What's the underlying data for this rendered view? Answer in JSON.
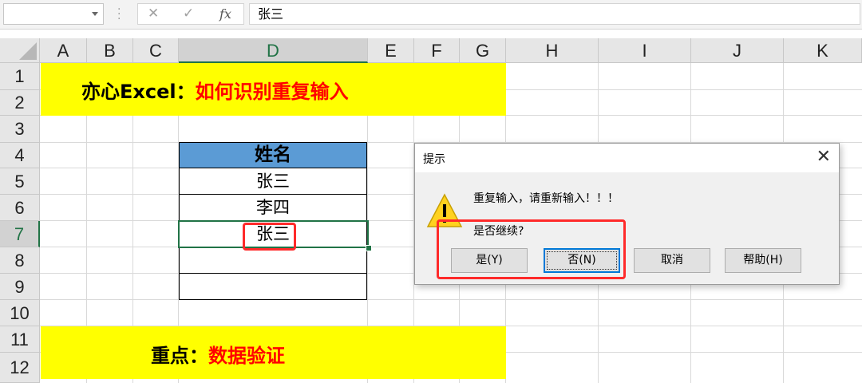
{
  "formula_bar": {
    "name_box": "",
    "cancel_symbol": "✕",
    "enter_symbol": "✓",
    "fx_label": "fx",
    "content": "张三"
  },
  "columns": [
    "A",
    "B",
    "C",
    "D",
    "E",
    "F",
    "G",
    "H",
    "I",
    "J",
    "K"
  ],
  "selected_column": "D",
  "rows": [
    "1",
    "2",
    "3",
    "4",
    "5",
    "6",
    "7",
    "8",
    "9",
    "10",
    "11",
    "12"
  ],
  "selected_row": "7",
  "sheet": {
    "title_black": "亦心Excel：",
    "title_red": "如何识别重复输入",
    "table_header": "姓名",
    "table_values": [
      "张三",
      "李四",
      "张三",
      "",
      ""
    ],
    "bottom_black": "重点：",
    "bottom_red": "数据验证"
  },
  "dialog": {
    "title": "提示",
    "close_symbol": "✕",
    "message": "重复输入，请重新输入！！！",
    "question": "是否继续?",
    "buttons": {
      "yes": "是(Y)",
      "no": "否(N)",
      "cancel": "取消",
      "help": "帮助(H)"
    }
  },
  "colors": {
    "excel_green": "#217346",
    "highlight_yellow": "#ffff00",
    "header_blue": "#5b9bd5",
    "annotation_red": "#ff2a2a"
  }
}
